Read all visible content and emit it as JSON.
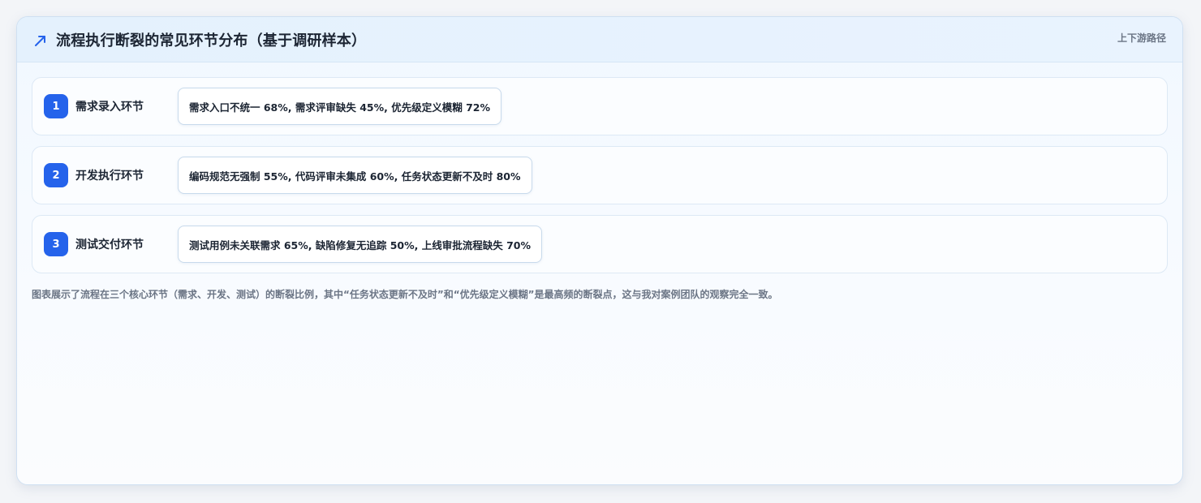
{
  "header": {
    "icon": "trend-up-arrow-icon",
    "title": "流程执行断裂的常见环节分布（基于调研样本）",
    "tag": "上下游路径",
    "accent_color": "#2563eb"
  },
  "steps": [
    {
      "number": "1",
      "label": "需求录入环节",
      "detail": "需求入口不统一 68%, 需求评审缺失 45%, 优先级定义模糊 72%"
    },
    {
      "number": "2",
      "label": "开发执行环节",
      "detail": "编码规范无强制 55%, 代码评审未集成 60%, 任务状态更新不及时 80%"
    },
    {
      "number": "3",
      "label": "测试交付环节",
      "detail": "测试用例未关联需求 65%, 缺陷修复无追踪 50%, 上线审批流程缺失 70%"
    }
  ],
  "caption": "图表展示了流程在三个核心环节（需求、开发、测试）的断裂比例，其中“任务状态更新不及时”和“优先级定义模糊”是最高频的断裂点，这与我对案例团队的观察完全一致。"
}
